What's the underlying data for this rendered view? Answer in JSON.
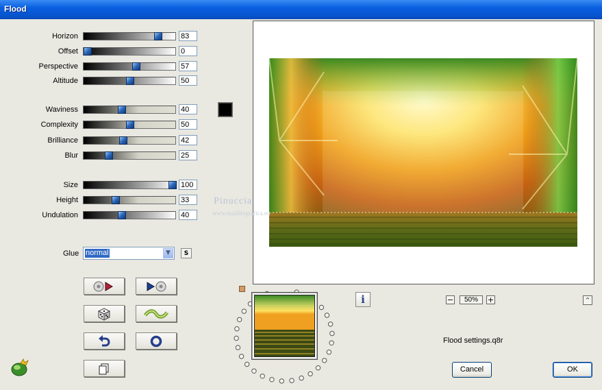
{
  "window": {
    "title": "Flood"
  },
  "sliders": [
    {
      "key": "horizon",
      "label": "Horizon",
      "value": "83",
      "fraction": 0.83
    },
    {
      "key": "offset",
      "label": "Offset",
      "value": "0",
      "fraction": 0.0
    },
    {
      "key": "perspective",
      "label": "Perspective",
      "value": "57",
      "fraction": 0.57
    },
    {
      "key": "altitude",
      "label": "Altitude",
      "value": "50",
      "fraction": 0.5
    },
    {
      "key": "waviness",
      "label": "Waviness",
      "value": "40",
      "fraction": 0.4
    },
    {
      "key": "complexity",
      "label": "Complexity",
      "value": "50",
      "fraction": 0.5
    },
    {
      "key": "brilliance",
      "label": "Brilliance",
      "value": "42",
      "fraction": 0.42
    },
    {
      "key": "blur",
      "label": "Blur",
      "value": "25",
      "fraction": 0.25
    },
    {
      "key": "size",
      "label": "Size",
      "value": "100",
      "fraction": 1.0
    },
    {
      "key": "height",
      "label": "Height",
      "value": "33",
      "fraction": 0.33
    },
    {
      "key": "undulation",
      "label": "Undulation",
      "value": "40",
      "fraction": 0.4
    }
  ],
  "color_swatch": {
    "color": "#000000"
  },
  "glue": {
    "label": "Glue",
    "value": "normal",
    "s_label": "S"
  },
  "buttons": [
    {
      "key": "prev-preset",
      "icon": "disc-arrow-right-icon"
    },
    {
      "key": "next-preset",
      "icon": "arrow-disc-icon"
    },
    {
      "key": "randomize",
      "icon": "dice-icon"
    },
    {
      "key": "wave",
      "icon": "wave-icon"
    },
    {
      "key": "undo",
      "icon": "undo-arrow-icon"
    },
    {
      "key": "reset",
      "icon": "ring-icon"
    },
    {
      "key": "copy",
      "icon": "copy-icon"
    }
  ],
  "zoom": {
    "minus": "−",
    "value": "50%",
    "plus": "+"
  },
  "info": {
    "label": "i"
  },
  "up": {
    "label": "^"
  },
  "settings_file": "Flood settings.q8r",
  "actions": {
    "cancel": "Cancel",
    "ok": "OK"
  },
  "watermark": {
    "name": "Pinuccia",
    "url": "www.maidiregrafica.eu"
  }
}
